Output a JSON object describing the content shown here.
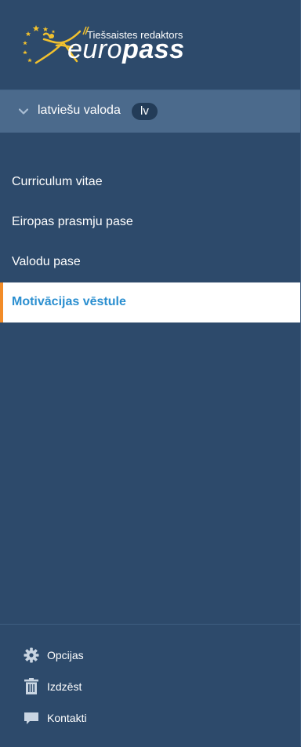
{
  "logo": {
    "tagline": "Tiešsaistes redaktors",
    "word_light": "euro",
    "word_bold": "pass",
    "star_color": "#f2c12e"
  },
  "language": {
    "label": "latviešu valoda",
    "code": "lv"
  },
  "nav": {
    "items": [
      {
        "label": "Curriculum vitae",
        "active": false
      },
      {
        "label": "Eiropas prasmju pase",
        "active": false
      },
      {
        "label": "Valodu pase",
        "active": false
      },
      {
        "label": "Motivācijas vēstule",
        "active": true
      }
    ]
  },
  "footer": {
    "items": [
      {
        "label": "Opcijas",
        "icon": "gear-icon"
      },
      {
        "label": "Izdzēst",
        "icon": "trash-icon"
      },
      {
        "label": "Kontakti",
        "icon": "speech-bubble-icon"
      }
    ]
  },
  "colors": {
    "sidebar_bg": "#2d4a6b",
    "lang_bar_bg": "#4b6a8c",
    "active_text": "#2b8fd0",
    "active_accent": "#f28c28"
  }
}
